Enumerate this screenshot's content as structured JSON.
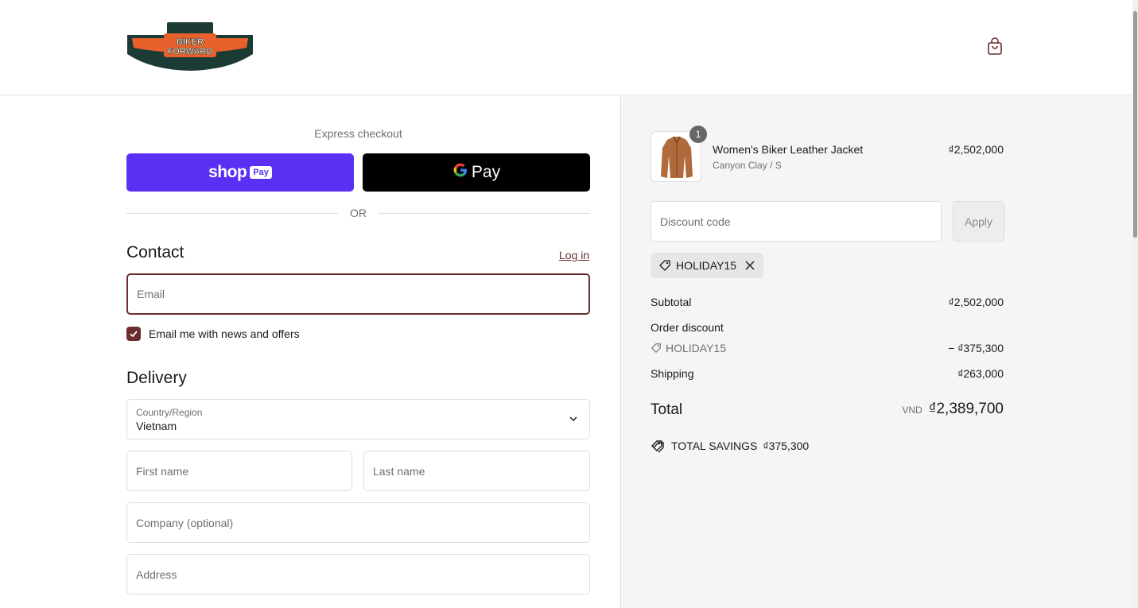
{
  "header": {
    "logo_text_line1": "BIKER",
    "logo_text_line2": "FORWARD"
  },
  "express": {
    "label": "Express checkout",
    "shop_pay_label": "shop",
    "shop_pay_badge": "Pay",
    "gpay_label": "Pay",
    "or_label": "OR"
  },
  "contact": {
    "title": "Contact",
    "login_label": "Log in",
    "email_placeholder": "Email",
    "newsletter_label": "Email me with news and offers",
    "newsletter_checked": true
  },
  "delivery": {
    "title": "Delivery",
    "country_label": "Country/Region",
    "country_value": "Vietnam",
    "first_name_placeholder": "First name",
    "last_name_placeholder": "Last name",
    "company_placeholder": "Company (optional)",
    "address_placeholder": "Address"
  },
  "summary": {
    "item": {
      "quantity": "1",
      "name": "Women's Biker Leather Jacket",
      "variant": "Canyon Clay / S",
      "price": "₫2,502,000"
    },
    "discount_placeholder": "Discount code",
    "apply_label": "Apply",
    "applied_code": "HOLIDAY15",
    "subtotal_label": "Subtotal",
    "subtotal_value": "₫2,502,000",
    "order_discount_label": "Order discount",
    "discount_code": "HOLIDAY15",
    "discount_value": "− ₫375,300",
    "shipping_label": "Shipping",
    "shipping_value": "₫263,000",
    "total_label": "Total",
    "total_currency": "VND",
    "total_value": "₫2,389,700",
    "savings_label": "TOTAL SAVINGS",
    "savings_value": "₫375,300"
  },
  "colors": {
    "brand": "#6b2d2d",
    "shop_pay": "#5a31f4",
    "gpay": "#000000"
  }
}
